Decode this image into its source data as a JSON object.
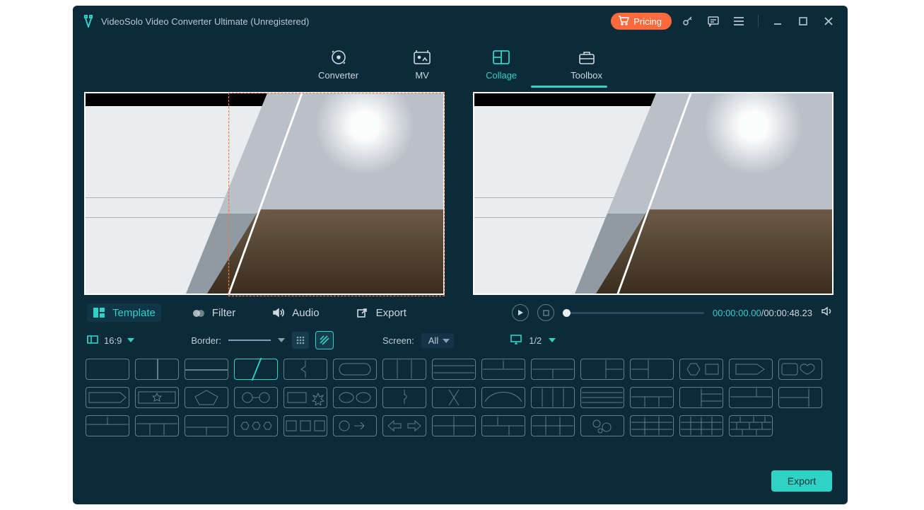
{
  "titlebar": {
    "title": "VideoSolo Video Converter Ultimate (Unregistered)",
    "pricing_label": "Pricing"
  },
  "nav": {
    "items": [
      {
        "label": "Converter"
      },
      {
        "label": "MV"
      },
      {
        "label": "Collage"
      },
      {
        "label": "Toolbox"
      }
    ]
  },
  "subtabs": {
    "template": "Template",
    "filter": "Filter",
    "audio": "Audio",
    "export": "Export"
  },
  "player": {
    "current": "00:00:00.00",
    "separator": "/",
    "duration": "00:00:48.23"
  },
  "options": {
    "aspect": "16:9",
    "border_label": "Border:",
    "screen_label": "Screen:",
    "screen_value": "All",
    "page": "1/2"
  },
  "footer": {
    "export": "Export"
  }
}
